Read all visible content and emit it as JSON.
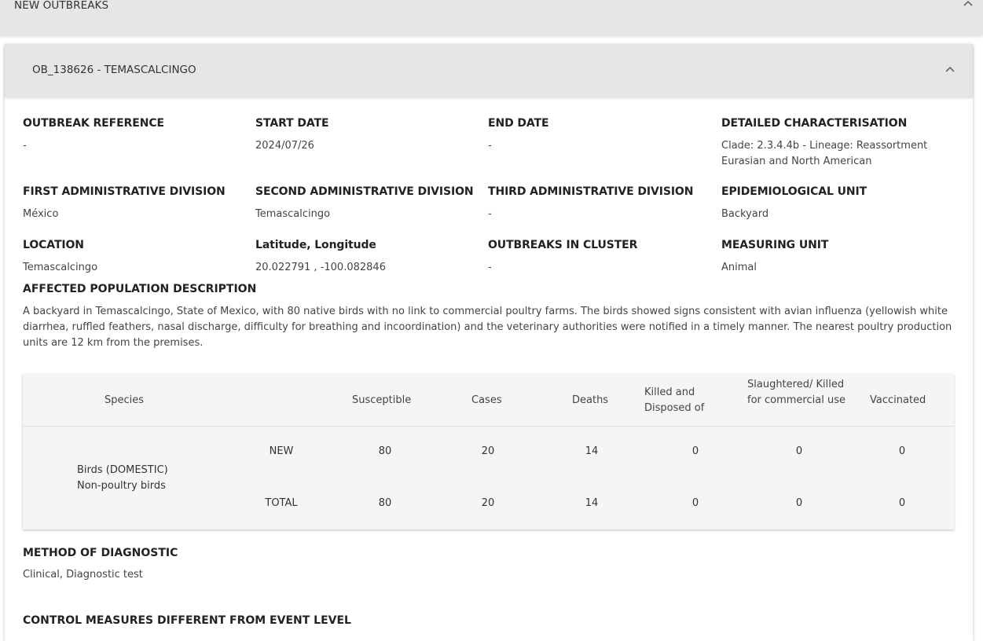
{
  "section": {
    "title": "NEW OUTBREAKS"
  },
  "outbreak": {
    "title": "OB_138626 - TEMASCALCINGO",
    "fields": [
      {
        "label": "OUTBREAK REFERENCE",
        "value": "-"
      },
      {
        "label": "START DATE",
        "value": "2024/07/26"
      },
      {
        "label": "END DATE",
        "value": "-"
      },
      {
        "label": "DETAILED CHARACTERISATION",
        "value": "Clade: 2.3.4.4b - Lineage: Reassortment Eurasian and North American"
      },
      {
        "label": "FIRST ADMINISTRATIVE DIVISION",
        "value": "México"
      },
      {
        "label": "SECOND ADMINISTRATIVE DIVISION",
        "value": "Temascalcingo"
      },
      {
        "label": "THIRD ADMINISTRATIVE DIVISION",
        "value": "-"
      },
      {
        "label": "EPIDEMIOLOGICAL UNIT",
        "value": "Backyard"
      },
      {
        "label": "LOCATION",
        "value": "Temascalcingo"
      },
      {
        "label": "Latitude, Longitude",
        "value": "20.022791 , -100.082846"
      },
      {
        "label": "OUTBREAKS IN CLUSTER",
        "value": "-"
      },
      {
        "label": "MEASURING UNIT",
        "value": "Animal"
      }
    ],
    "population": {
      "label": "AFFECTED POPULATION DESCRIPTION",
      "text": "A backyard in Temascalcingo, State of Mexico, with 80 native birds with no link to commercial poultry farms. The birds showed signs consistent with avian influenza (yellowish white diarrhea, ruffled feathers, nasal discharge, difficulty for breathing and incoordination) and the veterinary authorities were notified in a timely manner. The nearest poultry production units are 12 km from the premises."
    },
    "table": {
      "headers": {
        "species": "Species",
        "susceptible": "Susceptible",
        "cases": "Cases",
        "deaths": "Deaths",
        "killed": "Killed and Disposed of",
        "slaughtered": "Slaughtered/ Killed for commercial use",
        "vaccinated": "Vaccinated"
      },
      "species_line1": "Birds (DOMESTIC)",
      "species_line2": "Non-poultry birds",
      "rows": [
        {
          "type": "NEW",
          "values": [
            "80",
            "20",
            "14",
            "0",
            "0",
            "0"
          ]
        },
        {
          "type": "TOTAL",
          "values": [
            "80",
            "20",
            "14",
            "0",
            "0",
            "0"
          ]
        }
      ]
    },
    "diagnostic": {
      "label": "METHOD OF DIAGNOSTIC",
      "value": "Clinical, Diagnostic test"
    },
    "control": {
      "label": "CONTROL MEASURES DIFFERENT FROM EVENT LEVEL"
    }
  }
}
